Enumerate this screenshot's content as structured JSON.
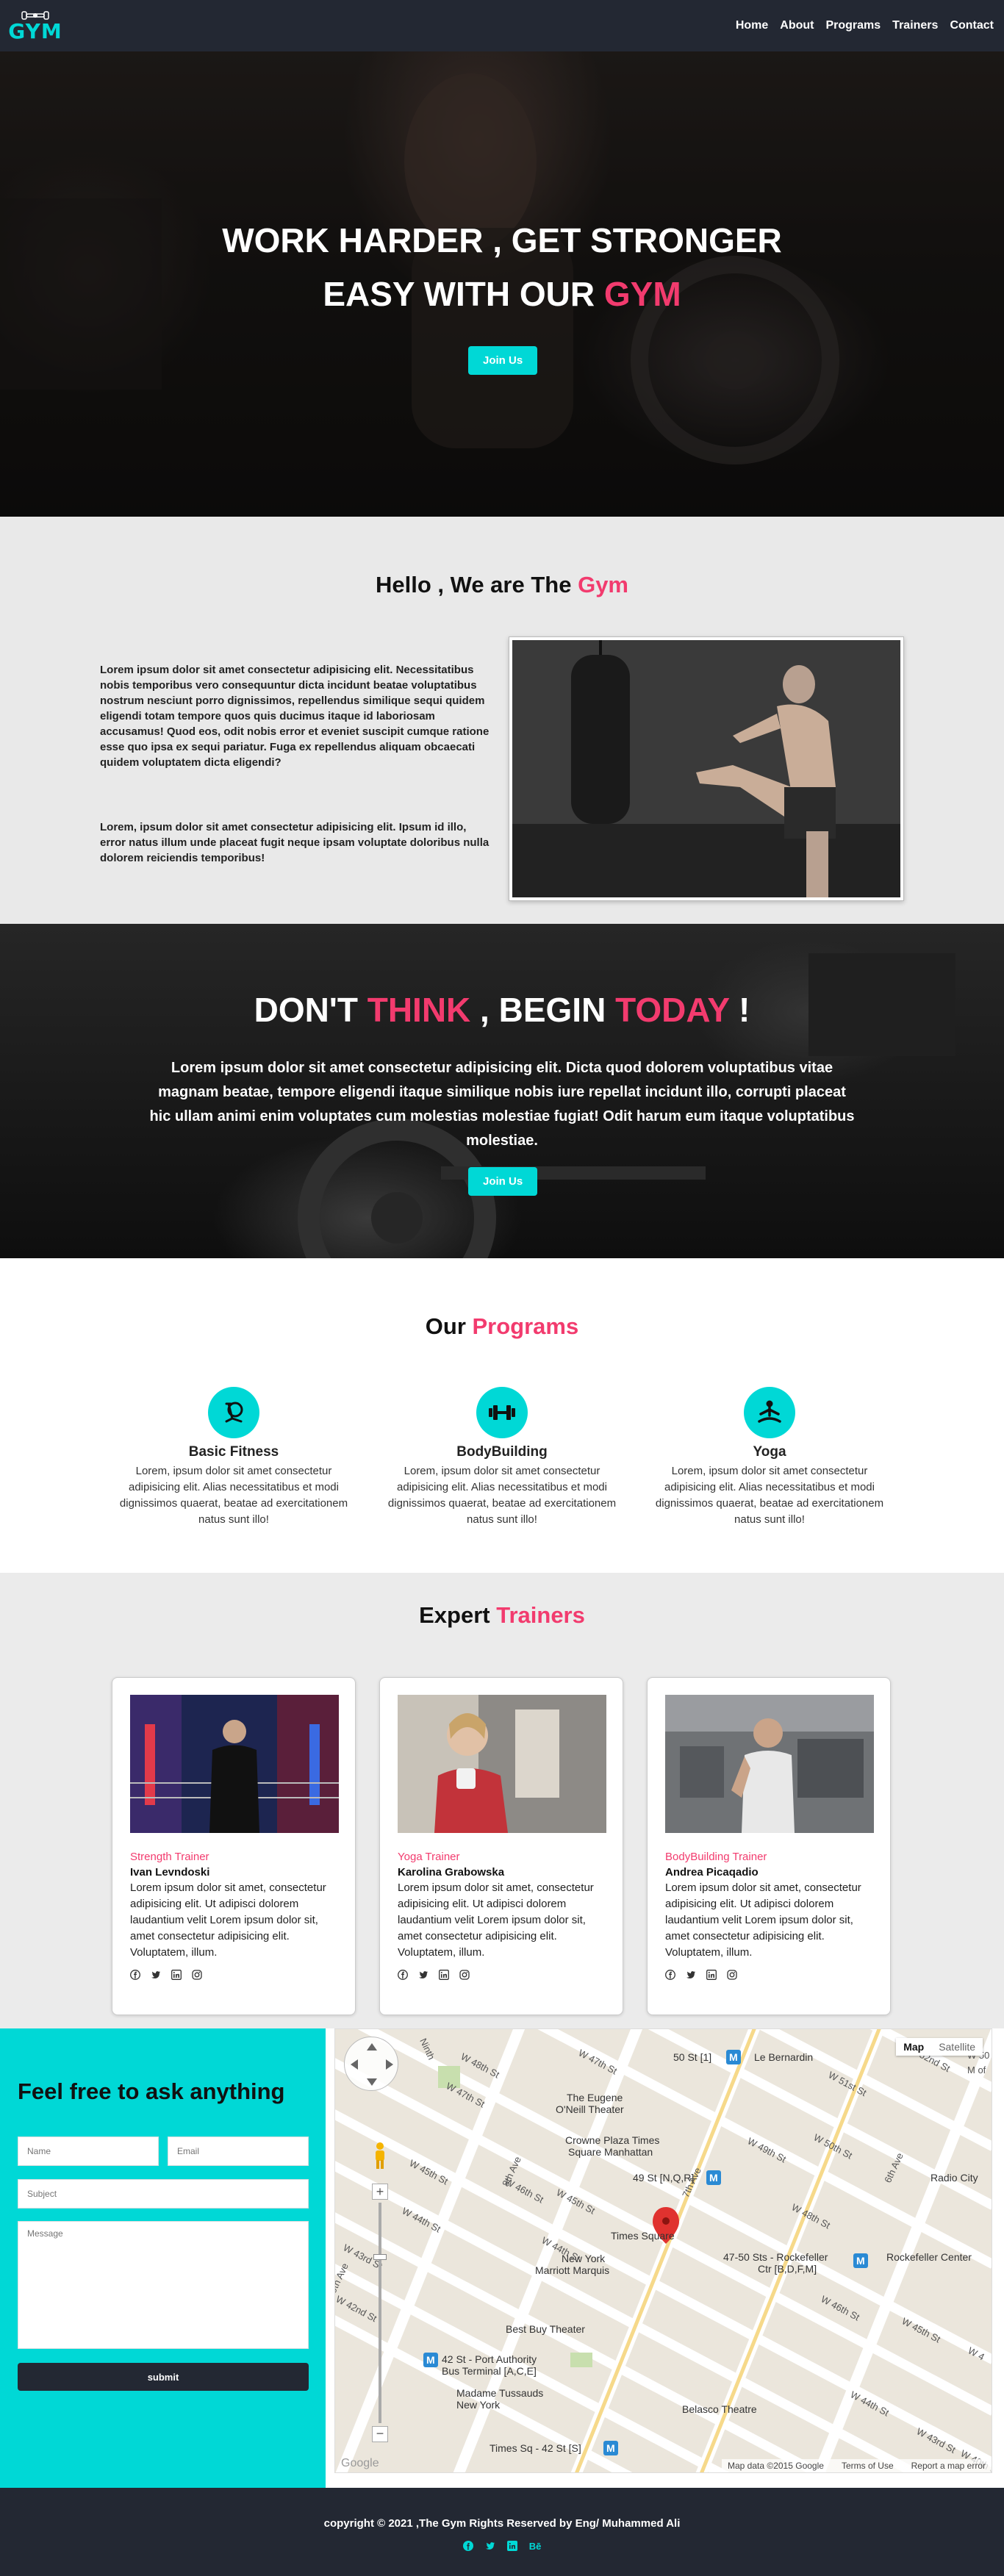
{
  "colors": {
    "accent_cyan": "#00d8d6",
    "accent_pink": "#f23b6e",
    "navbar": "#232833",
    "section_grey": "#e9e9e9"
  },
  "nav": {
    "logo_text": "GYM",
    "links": [
      "Home",
      "About",
      "Programs",
      "Trainers",
      "Contact"
    ]
  },
  "hero": {
    "line1": "WORK HARDER , GET STRONGER",
    "line2_prefix": "EASY WITH OUR ",
    "line2_accent": "GYM",
    "button": "Join Us"
  },
  "about": {
    "title_prefix": "Hello , We are The ",
    "title_accent": "Gym",
    "paragraph1": "Lorem ipsum dolor sit amet consectetur adipisicing elit. Necessitatibus nobis temporibus vero consequuntur dicta incidunt beatae voluptatibus nostrum nesciunt porro dignissimos, repellendus similique sequi quidem eligendi totam tempore quos quis ducimus itaque id laboriosam accusamus! Quod eos, odit nobis error et eveniet suscipit cumque ratione esse quo ipsa ex sequi pariatur. Fuga ex repellendus aliquam obcaecati quidem voluptatem dicta eligendi?",
    "paragraph2": "Lorem, ipsum dolor sit amet consectetur adipisicing elit. Ipsum id illo, error natus illum unde placeat fugit neque ipsam voluptate doloribus nulla dolorem reiciendis temporibus!"
  },
  "cta": {
    "t1": "DON'T ",
    "t2": "THINK",
    "t3": " , BEGIN ",
    "t4": "TODAY",
    "t5": " !",
    "text": "Lorem ipsum dolor sit amet consectetur adipisicing elit. Dicta quod dolorem voluptatibus vitae magnam beatae, tempore eligendi itaque similique nobis iure repellat incidunt illo, corrupti placeat hic ullam animi enim voluptates cum molestias molestiae fugiat! Odit harum eum itaque voluptatibus molestiae.",
    "button": "Join Us"
  },
  "programs": {
    "title_prefix": "Our ",
    "title_accent": "Programs",
    "items": [
      {
        "title": "Basic Fitness",
        "icon": "stationary-bike-icon",
        "text": "Lorem, ipsum dolor sit amet consectetur adipisicing elit. Alias necessitatibus et modi dignissimos quaerat, beatae ad exercitationem natus sunt illo!"
      },
      {
        "title": "BodyBuilding",
        "icon": "dumbbell-icon",
        "text": "Lorem, ipsum dolor sit amet consectetur adipisicing elit. Alias necessitatibus et modi dignissimos quaerat, beatae ad exercitationem natus sunt illo!"
      },
      {
        "title": "Yoga",
        "icon": "meditation-icon",
        "text": "Lorem, ipsum dolor sit amet consectetur adipisicing elit. Alias necessitatibus et modi dignissimos quaerat, beatae ad exercitationem natus sunt illo!"
      }
    ]
  },
  "trainers": {
    "title_prefix": "Expert ",
    "title_accent": "Trainers",
    "items": [
      {
        "role": "Strength Trainer",
        "name": "Ivan Levndoski",
        "text": "Lorem ipsum dolor sit amet, consectetur adipisicing elit. Ut adipisci dolorem laudantium velit Lorem ipsum dolor sit, amet consectetur adipisicing elit. Voluptatem, illum."
      },
      {
        "role": "Yoga Trainer",
        "name": "Karolina Grabowska",
        "text": "Lorem ipsum dolor sit amet, consectetur adipisicing elit. Ut adipisci dolorem laudantium velit Lorem ipsum dolor sit, amet consectetur adipisicing elit. Voluptatem, illum."
      },
      {
        "role": "BodyBuilding Trainer",
        "name": "Andrea Picaqadio",
        "text": "Lorem ipsum dolor sit amet, consectetur adipisicing elit. Ut adipisci dolorem laudantium velit Lorem ipsum dolor sit, amet consectetur adipisicing elit. Voluptatem, illum."
      }
    ],
    "social_icons": [
      "facebook-icon",
      "twitter-icon",
      "linkedin-icon",
      "instagram-icon"
    ]
  },
  "contact": {
    "title": "Feel free to ask anything",
    "name_placeholder": "Name",
    "email_placeholder": "Email",
    "subject_placeholder": "Subject",
    "message_placeholder": "Message",
    "submit": "submit"
  },
  "map": {
    "type_map": "Map",
    "type_satellite": "Satellite",
    "footer_data": "Map data ©2015 Google",
    "footer_terms": "Terms of Use",
    "footer_report": "Report a map error",
    "google_label": "Google",
    "labels": {
      "l1": "50 St [1]",
      "l2": "Le Bernardin",
      "l3": "The Eugene",
      "l4": "O'Neill Theater",
      "l5": "Crowne Plaza Times",
      "l6": "Square Manhattan",
      "l7": "49 St [N,Q,R]",
      "l8": "Radio City",
      "l9": "Times Square",
      "l10": "47-50 Sts - Rockefeller",
      "l11": "Ctr [B,D,F,M]",
      "l12": "Rockefeller Center",
      "l13": "New York",
      "l14": "Marriott Marquis",
      "l15": "Best Buy Theater",
      "l16": "42 St - Port Authority",
      "l17": "Bus Terminal [A,C,E]",
      "l18": "Madame Tussauds",
      "l19": "New York",
      "l20": "Belasco Theatre",
      "l21": "Times Sq - 42 St [S]",
      "s1": "W 48th St",
      "s2": "W 47th St",
      "s3": "W 46th St",
      "s4": "W 45th St",
      "s5": "W 44th St",
      "s6": "W 43rd St",
      "s7": "W 42nd St",
      "s8": "8th Ave",
      "s9": "7th Ave",
      "s10": "6th Ave",
      "s11": "W 52nd St",
      "s12": "W 51st St",
      "s13": "W 50th St",
      "s14": "W 49th St",
      "s15": "9th Ave",
      "s16": "W 47th St",
      "s17": "W 45th St",
      "s18": "W 44th St",
      "s19": "W 48th St",
      "s20": "W 46th St",
      "s21": "W 45th St",
      "s22": "W 44th St",
      "s23": "W 43rd St",
      "s24": "Ninth",
      "s25": "W 50",
      "s26": "M of",
      "s27": "W 4",
      "s28": "W 40th St"
    }
  },
  "footer": {
    "text": "copyright © 2021 ,The Gym Rights Reserved by Eng/ Muhammed Ali",
    "social_icons": [
      "facebook-icon",
      "twitter-icon",
      "linkedin-icon",
      "behance-icon"
    ],
    "behance_label": "Bē"
  }
}
